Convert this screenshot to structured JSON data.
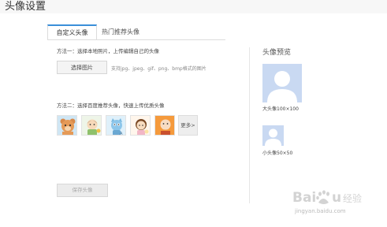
{
  "header": {
    "title": "头像设置"
  },
  "tabs": [
    {
      "label": "自定义头像"
    },
    {
      "label": "热门推荐头像"
    }
  ],
  "method1": {
    "label": "方法一：选择本地照片，上传编辑自己的头像",
    "upload_button": "选择图片",
    "formats": "支持jpg、jpeg、gif、png、bmp格式的图片"
  },
  "method2": {
    "label": "方法二：选择百度推荐头像，快速上传优质头像",
    "avatars": [
      "bear-icon",
      "child-icon",
      "cat-icon",
      "girl-icon",
      "grandpa-icon"
    ],
    "more_button": "更多>"
  },
  "save_button": "保存头像",
  "preview": {
    "title": "头像预览",
    "large_label": "大头像100×100",
    "small_label": "小头像50×50"
  },
  "watermark": {
    "brand": "Baidu 经验",
    "url": "jingyan.baidu.com"
  },
  "colors": {
    "tab_accent": "#3a8fd9",
    "placeholder_bg": "#c9d9f2",
    "placeholder_fg": "#ffffff"
  }
}
